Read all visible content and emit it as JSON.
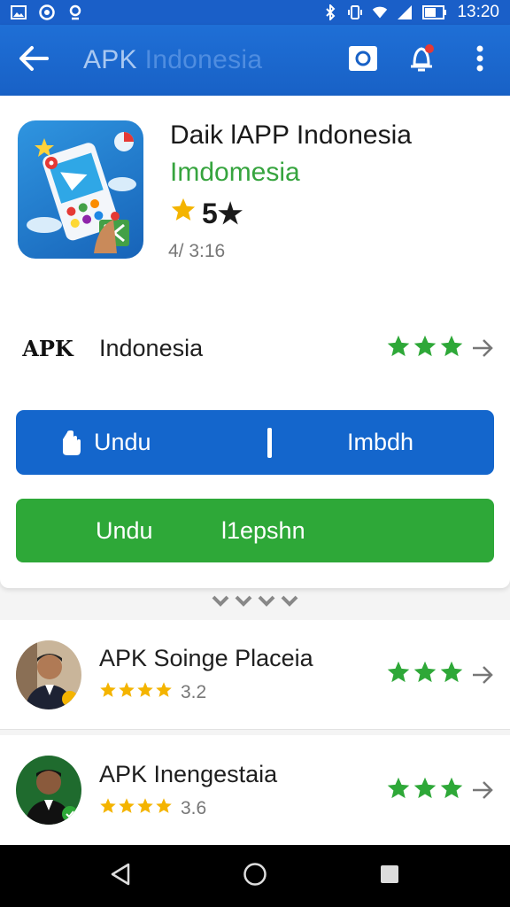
{
  "status_bar": {
    "time": "13:20",
    "icons": [
      "image-icon",
      "circle-badge-icon",
      "sync-icon",
      "bluetooth-icon",
      "vibrate-icon",
      "wifi-icon",
      "signal-icon",
      "battery-icon"
    ]
  },
  "app_bar": {
    "title_main": "APK",
    "title_faded": " Indonesia",
    "icons": [
      "back-arrow-icon",
      "camera-icon",
      "notification-bell-icon",
      "more-vertical-icon"
    ]
  },
  "app": {
    "name": "Daik lAPP Indonesia",
    "subtitle": "Imdomesia",
    "rating": "5★",
    "meta": "4/ 3:16"
  },
  "developer": {
    "avatar_text": "APK",
    "name": "Indonesia",
    "stars": 3
  },
  "buttons": {
    "primary_left": "Undu",
    "primary_right": "Imbdh",
    "secondary_left": "Undu",
    "secondary_right": "l1epshn"
  },
  "list": [
    {
      "title": "APK Soinge Placeia",
      "rating_value": "3.2",
      "stars": 4,
      "right_stars": 3
    },
    {
      "title": "APK Inengestaia",
      "rating_value": "3.6",
      "stars": 4,
      "right_stars": 3
    }
  ],
  "colors": {
    "primary": "#1466cc",
    "accent_green": "#2ea838",
    "star_yellow": "#f4b400",
    "star_green": "#2ea838"
  },
  "nav_bar": {
    "icons": [
      "nav-back-icon",
      "nav-home-icon",
      "nav-recents-icon"
    ]
  }
}
